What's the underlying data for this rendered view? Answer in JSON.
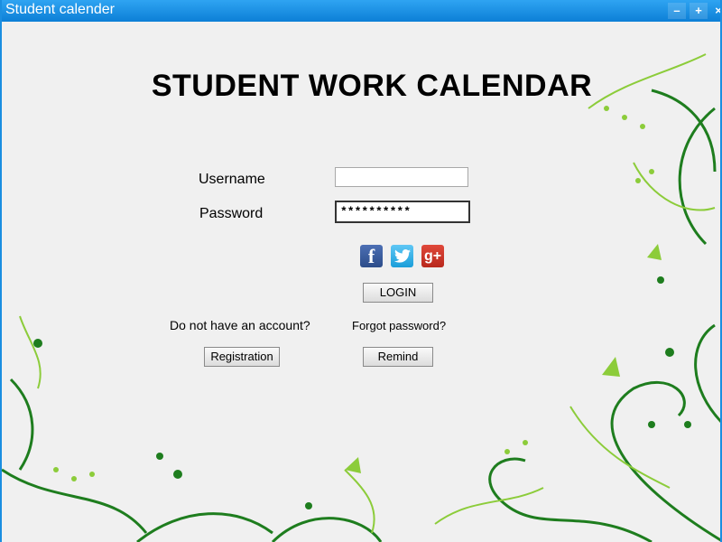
{
  "window": {
    "title": "Student calender",
    "controls": {
      "minimize": "–",
      "maximize": "+",
      "close": "×"
    },
    "frame_color": "#1a8ee0"
  },
  "app": {
    "heading": "STUDENT WORK CALENDAR"
  },
  "form": {
    "username_label": "Username",
    "username_value": "",
    "password_label": "Password",
    "password_value": "**********"
  },
  "social": {
    "facebook_glyph": "f",
    "twitter_glyph": "t",
    "google_glyph": "g+",
    "icons": [
      "facebook-icon",
      "twitter-icon",
      "google-plus-icon"
    ]
  },
  "buttons": {
    "login": "LOGIN",
    "registration": "Registration",
    "remind": "Remind"
  },
  "prompts": {
    "no_account": "Do not have an account?",
    "forgot_password": "Forgot password?"
  },
  "colors": {
    "decor_dark_green": "#1e7d1e",
    "decor_light_green": "#8ccc3a",
    "decor_gray": "#8a8a8a"
  }
}
